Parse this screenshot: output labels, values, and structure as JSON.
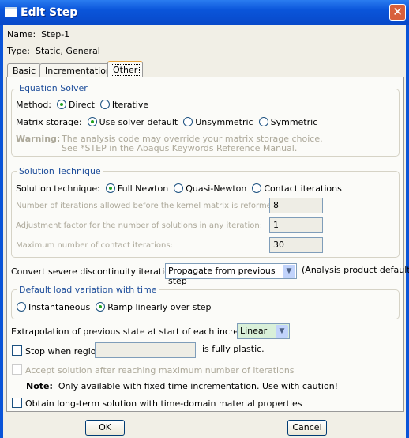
{
  "window": {
    "title": "Edit Step",
    "close": "✕"
  },
  "name_label": "Name:",
  "name_value": "Step-1",
  "type_label": "Type:",
  "type_value": "Static, General",
  "tabs": [
    {
      "label": "Basic"
    },
    {
      "label": "Incrementation"
    },
    {
      "label": "Other",
      "active": true
    }
  ],
  "equation_solver": {
    "title": "Equation Solver",
    "method_label": "Method:",
    "method_options": [
      "Direct",
      "Iterative"
    ],
    "method_selected": "Direct",
    "matrix_label": "Matrix storage:",
    "matrix_options": [
      "Use solver default",
      "Unsymmetric",
      "Symmetric"
    ],
    "matrix_selected": "Use solver default",
    "warning_label": "Warning:",
    "warning_line1": "The analysis code may override your matrix storage choice.",
    "warning_line2": "See *STEP in the Abaqus Keywords Reference Manual."
  },
  "solution_technique": {
    "title": "Solution Technique",
    "label": "Solution technique:",
    "options": [
      "Full Newton",
      "Quasi-Newton",
      "Contact iterations"
    ],
    "selected": "Full Newton",
    "fields": [
      {
        "label": "Number of iterations allowed before the kernel matrix is reformed:",
        "value": "8"
      },
      {
        "label": "Adjustment factor for the number of solutions in any iteration:",
        "value": "1"
      },
      {
        "label": "Maximum number of contact iterations:",
        "value": "30"
      }
    ]
  },
  "convert": {
    "label": "Convert severe discontinuity iterations:",
    "value": "Propagate from previous step",
    "note": "(Analysis product default)"
  },
  "load_variation": {
    "title": "Default load variation with time",
    "options": [
      "Instantaneous",
      "Ramp linearly over step"
    ],
    "selected": "Ramp linearly over step"
  },
  "extrapolation": {
    "label": "Extrapolation of previous state at start of each increment:",
    "value": "Linear"
  },
  "stop_region": {
    "label": "Stop when region",
    "suffix": "is fully plastic.",
    "value": "",
    "checked": false
  },
  "accept_solution": {
    "label": "Accept solution after reaching maximum number of iterations",
    "checked": false,
    "disabled": true
  },
  "note": {
    "label": "Note:",
    "text": "Only available with fixed time incrementation. Use with caution!"
  },
  "long_term": {
    "label": "Obtain long-term solution with time-domain material properties",
    "checked": false
  },
  "buttons": {
    "ok": "OK",
    "cancel": "Cancel"
  },
  "colors": {
    "titlebar": "#0a55da",
    "group_title": "#1d4d9a",
    "tab_highlight": "#e8a33c"
  }
}
